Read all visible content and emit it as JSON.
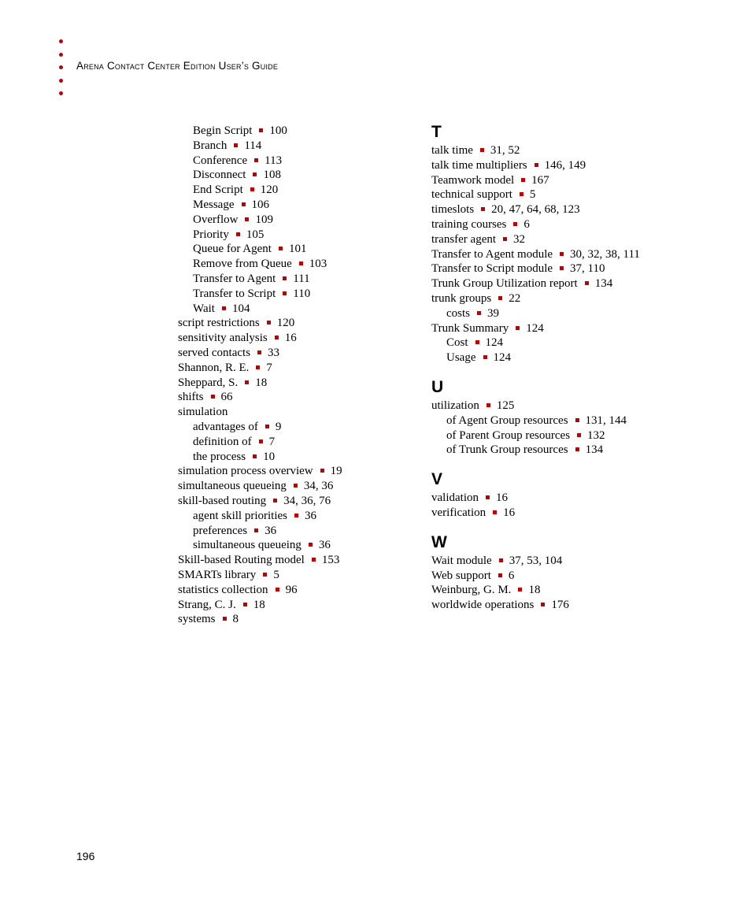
{
  "header": {
    "title": "Arena Contact Center Edition User’s Guide",
    "bullet_color": "#c00000",
    "bullet_count": 5
  },
  "left_column": [
    {
      "term": "Begin Script",
      "pages": "100",
      "level": 1
    },
    {
      "term": "Branch",
      "pages": "114",
      "level": 1
    },
    {
      "term": "Conference",
      "pages": "113",
      "level": 1
    },
    {
      "term": "Disconnect",
      "pages": "108",
      "level": 1
    },
    {
      "term": "End Script",
      "pages": "120",
      "level": 1
    },
    {
      "term": "Message",
      "pages": "106",
      "level": 1
    },
    {
      "term": "Overflow",
      "pages": "109",
      "level": 1
    },
    {
      "term": "Priority",
      "pages": "105",
      "level": 1
    },
    {
      "term": "Queue for Agent",
      "pages": "101",
      "level": 1
    },
    {
      "term": "Remove from Queue",
      "pages": "103",
      "level": 1
    },
    {
      "term": "Transfer to Agent",
      "pages": "111",
      "level": 1
    },
    {
      "term": "Transfer to Script",
      "pages": "110",
      "level": 1
    },
    {
      "term": "Wait",
      "pages": "104",
      "level": 1
    },
    {
      "term": "script restrictions",
      "pages": "120",
      "level": 0
    },
    {
      "term": "sensitivity analysis",
      "pages": "16",
      "level": 0
    },
    {
      "term": "served contacts",
      "pages": "33",
      "level": 0
    },
    {
      "term": "Shannon, R. E.",
      "pages": "7",
      "level": 0
    },
    {
      "term": "Sheppard, S.",
      "pages": "18",
      "level": 0
    },
    {
      "term": "shifts",
      "pages": "66",
      "level": 0
    },
    {
      "term": "simulation",
      "pages": "",
      "level": 0
    },
    {
      "term": "advantages of",
      "pages": "9",
      "level": 1
    },
    {
      "term": "definition of",
      "pages": "7",
      "level": 1
    },
    {
      "term": "the process",
      "pages": "10",
      "level": 1
    },
    {
      "term": "simulation process overview",
      "pages": "19",
      "level": 0
    },
    {
      "term": "simultaneous queueing",
      "pages": "34, 36",
      "level": 0
    },
    {
      "term": "skill-based routing",
      "pages": "34, 36, 76",
      "level": 0
    },
    {
      "term": "agent skill priorities",
      "pages": "36",
      "level": 1
    },
    {
      "term": "preferences",
      "pages": "36",
      "level": 1
    },
    {
      "term": "simultaneous queueing",
      "pages": "36",
      "level": 1
    },
    {
      "term": "Skill-based Routing model",
      "pages": "153",
      "level": 0
    },
    {
      "term": "SMARTs library",
      "pages": "5",
      "level": 0
    },
    {
      "term": "statistics collection",
      "pages": "96",
      "level": 0
    },
    {
      "term": "Strang, C. J.",
      "pages": "18",
      "level": 0
    },
    {
      "term": "systems",
      "pages": "8",
      "level": 0
    }
  ],
  "right_column": [
    {
      "letter": "T",
      "entries": [
        {
          "term": "talk time",
          "pages": "31, 52",
          "level": 0
        },
        {
          "term": "talk time multipliers",
          "pages": "146, 149",
          "level": 0
        },
        {
          "term": "Teamwork model",
          "pages": "167",
          "level": 0
        },
        {
          "term": "technical support",
          "pages": "5",
          "level": 0
        },
        {
          "term": "timeslots",
          "pages": "20, 47, 64, 68, 123",
          "level": 0
        },
        {
          "term": "training courses",
          "pages": "6",
          "level": 0
        },
        {
          "term": "transfer agent",
          "pages": "32",
          "level": 0
        },
        {
          "term": "Transfer to Agent module",
          "pages": "30, 32, 38, 111",
          "level": 0
        },
        {
          "term": "Transfer to Script module",
          "pages": "37, 110",
          "level": 0
        },
        {
          "term": "Trunk Group Utilization report",
          "pages": "134",
          "level": 0
        },
        {
          "term": "trunk groups",
          "pages": "22",
          "level": 0
        },
        {
          "term": "costs",
          "pages": "39",
          "level": 1
        },
        {
          "term": "Trunk Summary",
          "pages": "124",
          "level": 0
        },
        {
          "term": "Cost",
          "pages": "124",
          "level": 1
        },
        {
          "term": "Usage",
          "pages": "124",
          "level": 1
        }
      ]
    },
    {
      "letter": "U",
      "entries": [
        {
          "term": "utilization",
          "pages": "125",
          "level": 0
        },
        {
          "term": "of Agent Group resources",
          "pages": "131, 144",
          "level": 1
        },
        {
          "term": "of Parent Group resources",
          "pages": "132",
          "level": 1
        },
        {
          "term": "of Trunk Group resources",
          "pages": "134",
          "level": 1
        }
      ]
    },
    {
      "letter": "V",
      "entries": [
        {
          "term": "validation",
          "pages": "16",
          "level": 0
        },
        {
          "term": "verification",
          "pages": "16",
          "level": 0
        }
      ]
    },
    {
      "letter": "W",
      "entries": [
        {
          "term": "Wait module",
          "pages": "37, 53, 104",
          "level": 0
        },
        {
          "term": "Web support",
          "pages": "6",
          "level": 0
        },
        {
          "term": "Weinburg, G. M.",
          "pages": "18",
          "level": 0
        },
        {
          "term": "worldwide operations",
          "pages": "176",
          "level": 0
        }
      ]
    }
  ],
  "footer": {
    "page_number": "196"
  }
}
